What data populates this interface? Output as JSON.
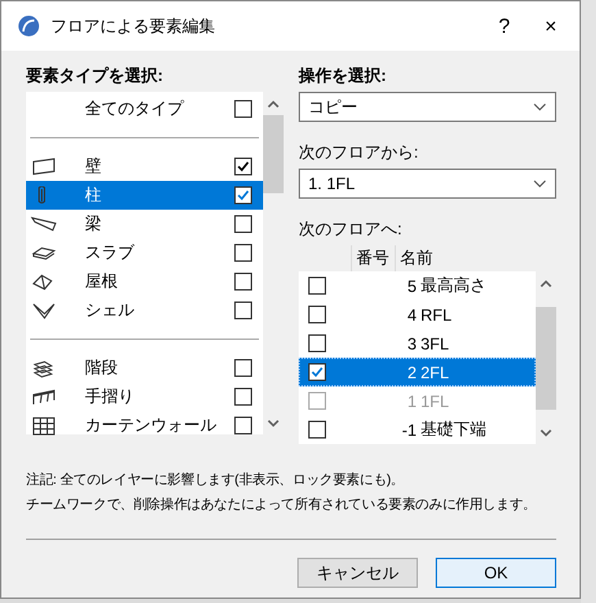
{
  "window": {
    "title": "フロアによる要素編集",
    "help": "?",
    "close": "×"
  },
  "element_types": {
    "label": "要素タイプを選択:",
    "all_types": {
      "label": "全てのタイプ",
      "checked": false
    },
    "groups": [
      {
        "items": [
          {
            "name": "壁",
            "checked": true,
            "selected": false
          },
          {
            "name": "柱",
            "checked": true,
            "selected": true
          },
          {
            "name": "梁",
            "checked": false,
            "selected": false
          },
          {
            "name": "スラブ",
            "checked": false,
            "selected": false
          },
          {
            "name": "屋根",
            "checked": false,
            "selected": false
          },
          {
            "name": "シェル",
            "checked": false,
            "selected": false
          }
        ]
      },
      {
        "items": [
          {
            "name": "階段",
            "checked": false,
            "selected": false
          },
          {
            "name": "手摺り",
            "checked": false,
            "selected": false
          },
          {
            "name": "カーテンウォール",
            "checked": false,
            "selected": false
          }
        ]
      }
    ]
  },
  "operation": {
    "label": "操作を選択:",
    "value": "コピー"
  },
  "from_floor": {
    "label": "次のフロアから:",
    "value": "1. 1FL"
  },
  "to_floors": {
    "label": "次のフロアへ:",
    "columns": [
      "番号",
      "名前"
    ],
    "rows": [
      {
        "number": "5",
        "name": "最高高さ",
        "checked": false,
        "selected": false,
        "disabled": false
      },
      {
        "number": "4",
        "name": "RFL",
        "checked": false,
        "selected": false,
        "disabled": false
      },
      {
        "number": "3",
        "name": "3FL",
        "checked": false,
        "selected": false,
        "disabled": false
      },
      {
        "number": "2",
        "name": "2FL",
        "checked": true,
        "selected": true,
        "disabled": false
      },
      {
        "number": "1",
        "name": "1FL",
        "checked": false,
        "selected": false,
        "disabled": true
      },
      {
        "number": "-1",
        "name": "基礎下端",
        "checked": false,
        "selected": false,
        "disabled": false
      }
    ]
  },
  "notes": [
    "注記: 全てのレイヤーに影響します(非表示、ロック要素にも)。",
    "チームワークで、削除操作はあなたによって所有されている要素のみに作用します。"
  ],
  "buttons": {
    "cancel": "キャンセル",
    "ok": "OK"
  }
}
